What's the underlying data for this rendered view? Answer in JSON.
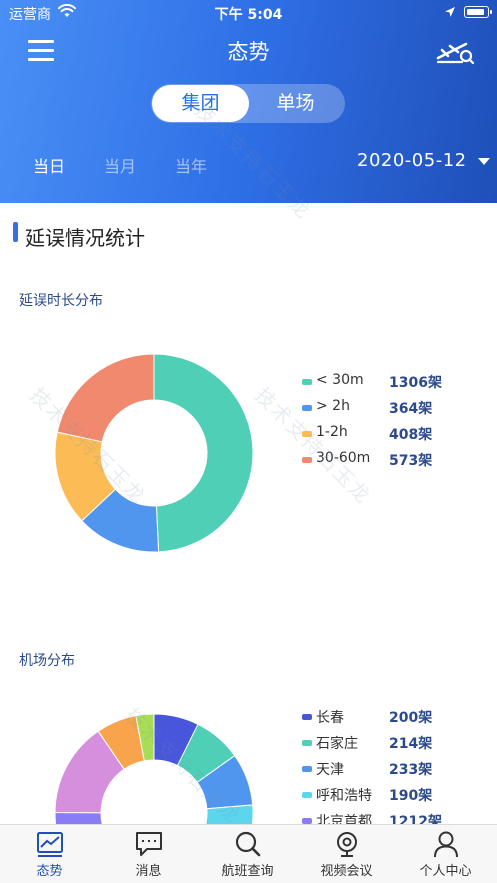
{
  "status_bar": {
    "carrier": "运营商",
    "time": "下午 5:04",
    "battery_level": 0.9
  },
  "nav": {
    "title": "态势",
    "menu_icon": "menu-icon",
    "flight_icon": "flight-search-icon"
  },
  "segment": {
    "options": [
      "集团",
      "单场"
    ],
    "selected": "集团"
  },
  "periods": [
    "当日",
    "当月",
    "当年"
  ],
  "selected_period": "当日",
  "date": "2020-05-12",
  "section_title": "延误情况统计",
  "delay_chart": {
    "subtitle": "延误时长分布",
    "chart_data": {
      "type": "pie",
      "title": "延误时长分布",
      "donut": true,
      "categories": [
        "< 30m",
        "> 2h",
        "1-2h",
        "30-60m"
      ],
      "values": [
        1306,
        364,
        408,
        573
      ],
      "unit": "架",
      "colors": [
        "#4fcfb5",
        "#5196ee",
        "#fbbb55",
        "#f0896d"
      ],
      "legend": "right"
    }
  },
  "airport_chart": {
    "subtitle": "机场分布",
    "chart_data": {
      "type": "pie",
      "title": "机场分布",
      "donut": true,
      "categories": [
        "长春",
        "石家庄",
        "天津",
        "呼和浩特",
        "北京首都"
      ],
      "values": [
        200,
        214,
        233,
        190,
        1212
      ],
      "unit": "架",
      "colors": [
        "#4856dc",
        "#4fcfb5",
        "#5196ee",
        "#5cd6ec",
        "#8a7cf2"
      ],
      "hidden_segment_colors": [
        "#8a7cf2",
        "#d58fdc",
        "#f7a44c",
        "#a8dd55"
      ],
      "legend": "right"
    }
  },
  "watermark": "技术支持石玉龙",
  "tabs": [
    {
      "label": "态势",
      "icon": "trend-chart-icon",
      "active": true
    },
    {
      "label": "消息",
      "icon": "message-icon",
      "active": false
    },
    {
      "label": "航班查询",
      "icon": "flight-query-icon",
      "active": false
    },
    {
      "label": "视频会议",
      "icon": "video-conference-icon",
      "active": false
    },
    {
      "label": "个人中心",
      "icon": "user-icon",
      "active": false
    }
  ],
  "colors": {
    "primary": "#2f6fe6",
    "primary_dark": "#1f4fb8",
    "legend_value": "#2b4a8c"
  }
}
